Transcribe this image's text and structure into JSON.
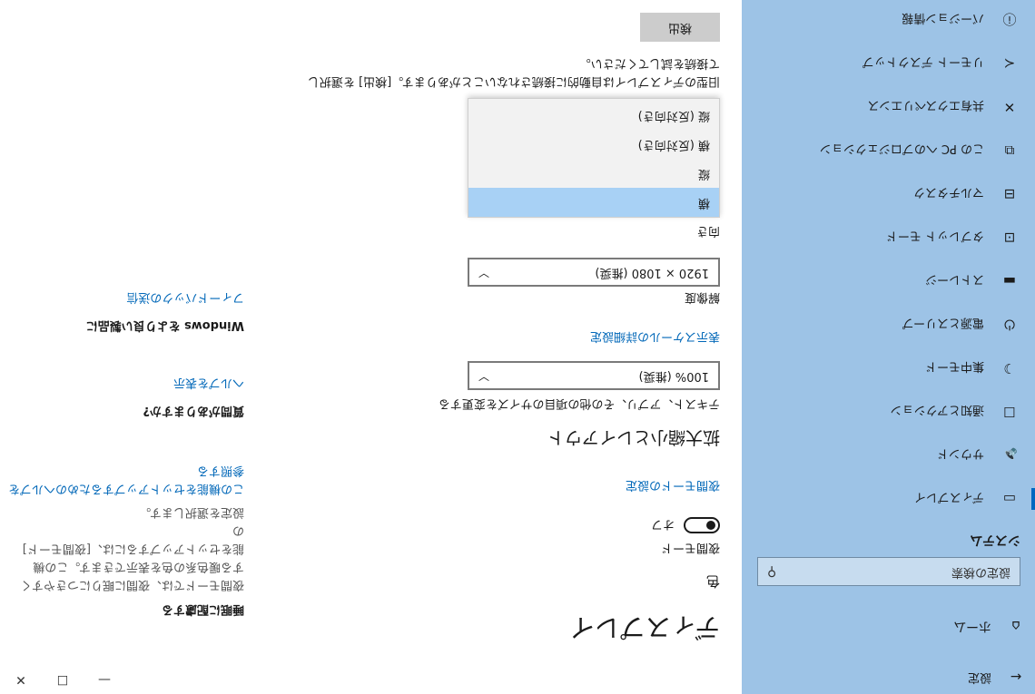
{
  "window": {
    "title": "設定",
    "controls": {
      "minimize": "—",
      "maximize": "☐",
      "close": "✕"
    }
  },
  "sidebar": {
    "home_label": "ホーム",
    "search_placeholder": "設定の検索",
    "section_title": "システム",
    "items": [
      {
        "icon": "display-icon",
        "glyph": "▭",
        "label": "ディスプレイ",
        "selected": true
      },
      {
        "icon": "sound-icon",
        "glyph": "🔈",
        "label": "サウンド"
      },
      {
        "icon": "notification-icon",
        "glyph": "☐",
        "label": "通知とアクション"
      },
      {
        "icon": "focus-assist-icon",
        "glyph": "☽",
        "label": "集中モード"
      },
      {
        "icon": "power-icon",
        "glyph": "⏻",
        "label": "電源とスリープ"
      },
      {
        "icon": "storage-icon",
        "glyph": "▬",
        "label": "ストレージ"
      },
      {
        "icon": "tablet-icon",
        "glyph": "⊡",
        "label": "タブレット モード"
      },
      {
        "icon": "multitasking-icon",
        "glyph": "⊟",
        "label": "マルチタスク"
      },
      {
        "icon": "projecting-icon",
        "glyph": "⧉",
        "label": "この PC へのプロジェクション"
      },
      {
        "icon": "shared-experiences-icon",
        "glyph": "✕",
        "label": "共有エクスペリエンス"
      },
      {
        "icon": "remote-desktop-icon",
        "glyph": "≺",
        "label": "リモート デスクトップ"
      },
      {
        "icon": "about-icon",
        "glyph": "ⓘ",
        "label": "バージョン情報"
      }
    ]
  },
  "main": {
    "title": "ディスプレイ",
    "color_label": "色",
    "night_light_label": "夜間モード",
    "night_light_state": "オフ",
    "night_light_link": "夜間モードの設定",
    "scale_heading": "拡大縮小とレイアウト",
    "scale_desc": "テキスト、アプリ、その他の項目のサイズを変更する",
    "scale_value": "100% (推奨)",
    "advanced_scaling_link": "表示スケールの詳細設定",
    "resolution_label": "解像度",
    "resolution_value": "1920 × 1080 (推奨)",
    "orientation_label": "向き",
    "orientation_options": [
      "横",
      "縦",
      "横 (反対向き)",
      "縦 (反対向き)"
    ],
    "orientation_selected": "横",
    "detect_desc_line1": "旧型のディスプレイは自動的に接続されないことがあります。[検出] を選択し",
    "detect_desc_line2": "て接続を試してください。",
    "detect_button": "検出",
    "right": {
      "sleep_heading": "睡眠に配慮する",
      "sleep_desc": [
        "夜間モードでは、夜間に眠りにつきやすく",
        "する暖色系の色を表示できます。この機",
        "能をセットアップするには、[夜間モード] の",
        "設定を選択します。"
      ],
      "sleep_link": [
        "この機能をセットアップするためのヘルプを",
        "参照する"
      ],
      "question": "質問がありますか?",
      "help_link": "ヘルプを表示",
      "improve_heading": "Windows をより良い製品に",
      "feedback_link": "フィードバックの送信"
    }
  }
}
